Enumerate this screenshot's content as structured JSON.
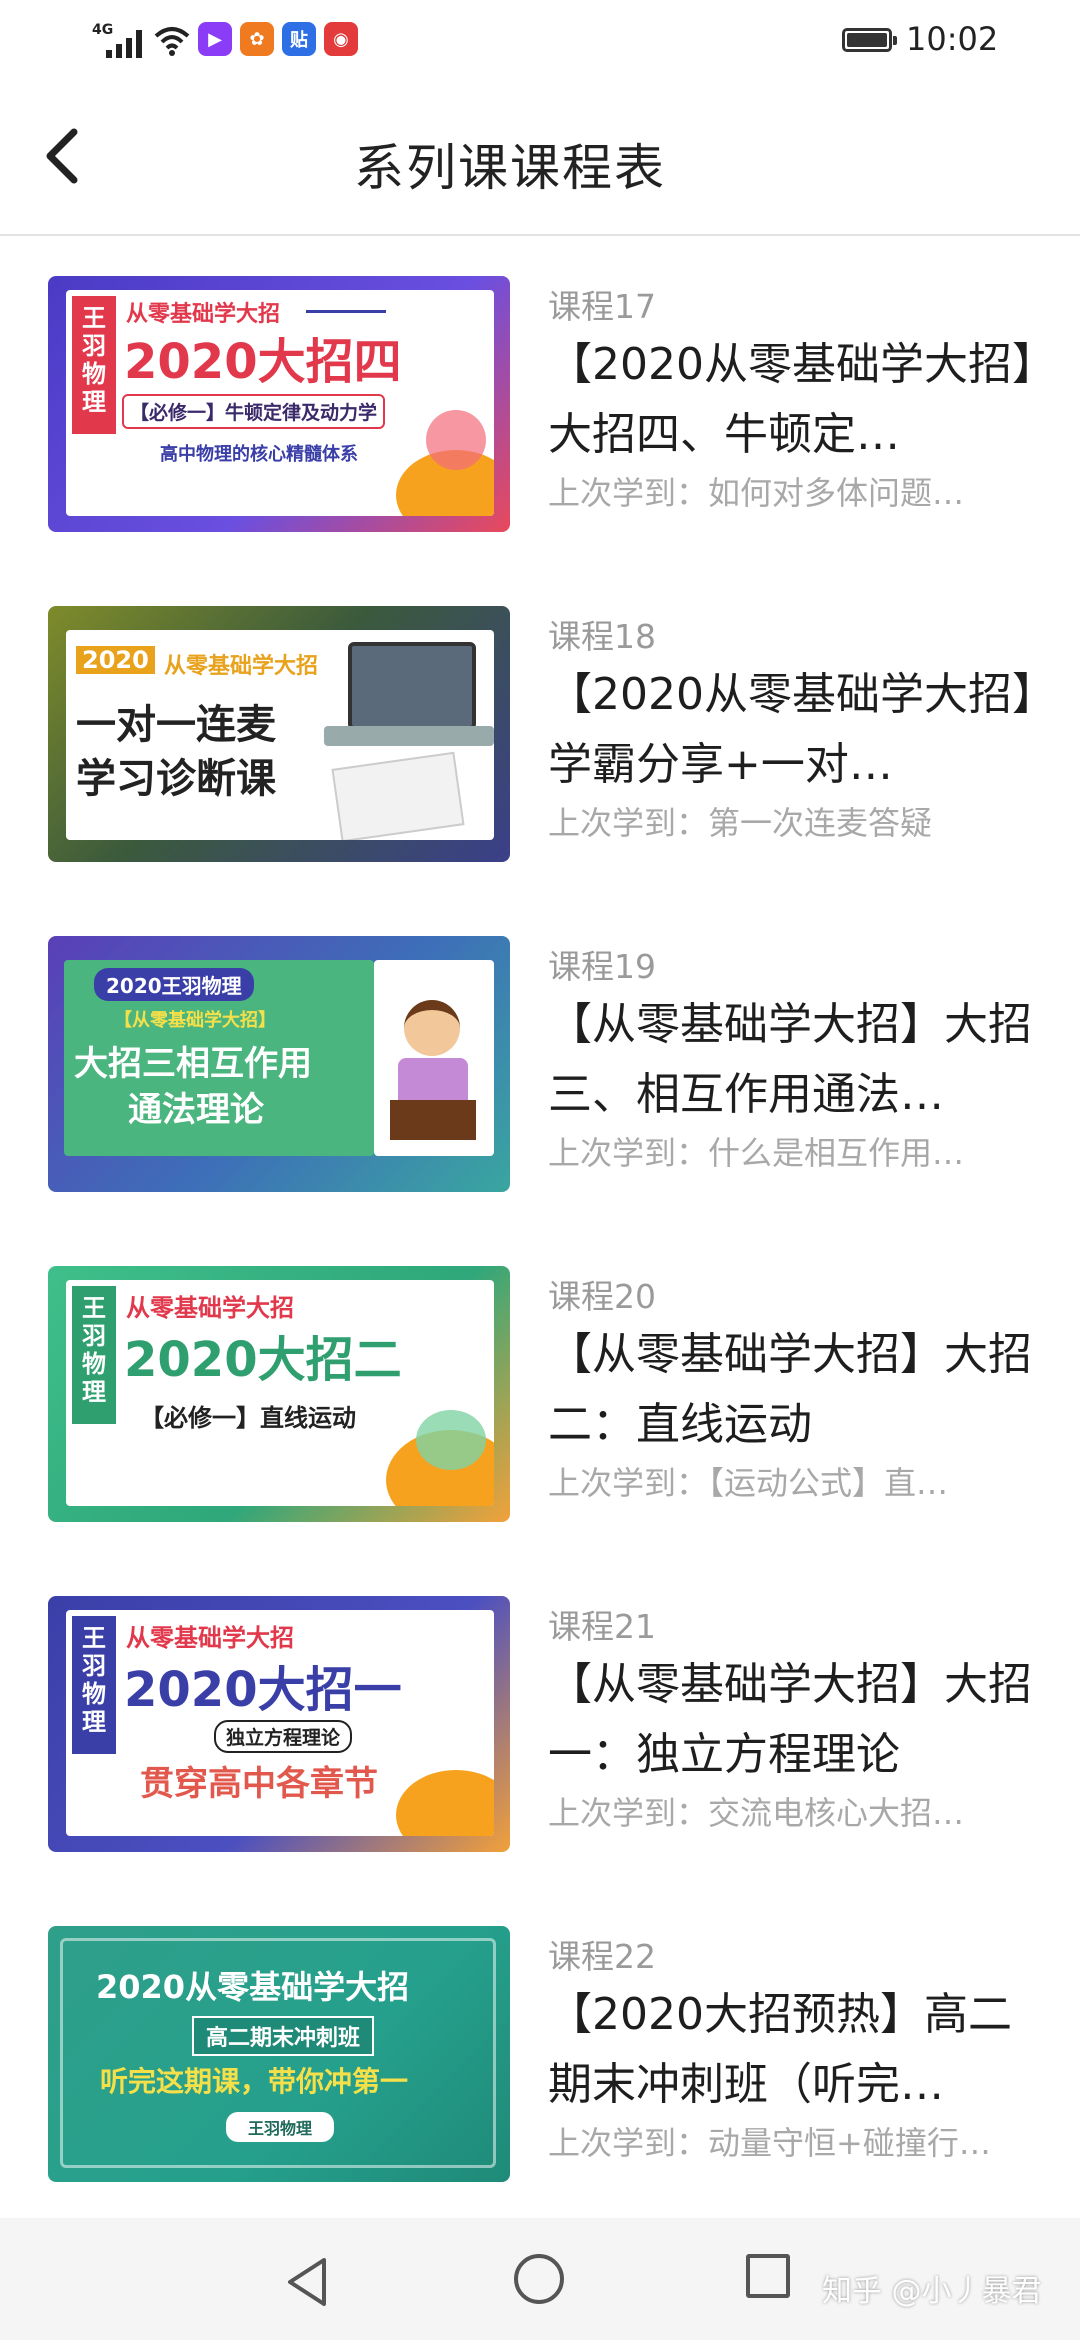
{
  "status_bar": {
    "network": "4G",
    "time": "10:02",
    "app_icons": [
      {
        "name": "video-app-icon",
        "glyph": "▶",
        "color": "#8b3cf7"
      },
      {
        "name": "weibo-icon",
        "glyph": "✿",
        "color": "#f07a20"
      },
      {
        "name": "tieba-icon",
        "glyph": "贴",
        "color": "#2f6fe6"
      },
      {
        "name": "netease-music-icon",
        "glyph": "◉",
        "color": "#e33b3b"
      }
    ]
  },
  "header": {
    "title": "系列课课程表",
    "back_icon": "chevron-left-icon"
  },
  "courses": [
    {
      "number": "课程17",
      "title": "【2020从零基础学大招】大招四、牛顿定…",
      "last": "上次学到：如何对多体问题…",
      "thumb": {
        "badge": "王羽物理",
        "line1": "从零基础学大招",
        "line2": "2020大招四",
        "line3": "【必修一】牛顿定律及动力学",
        "line4": "高中物理的核心精髓体系"
      }
    },
    {
      "number": "课程18",
      "title": "【2020从零基础学大招】学霸分享+一对…",
      "last": "上次学到：第一次连麦答疑",
      "thumb": {
        "year": "2020",
        "line1": "从零基础学大招",
        "line2": "一对一连麦",
        "line3": "学习诊断课"
      }
    },
    {
      "number": "课程19",
      "title": "【从零基础学大招】大招三、相互作用通法…",
      "last": "上次学到：什么是相互作用…",
      "thumb": {
        "line1": "2020王羽物理",
        "line2": "【从零基础学大招】",
        "line3": "大招三相互作用",
        "line4": "通法理论"
      }
    },
    {
      "number": "课程20",
      "title": "【从零基础学大招】大招二：直线运动",
      "last": "上次学到：【运动公式】直…",
      "thumb": {
        "badge": "王羽物理",
        "line1": "从零基础学大招",
        "line2": "2020大招二",
        "line3": "【必修一】直线运动"
      }
    },
    {
      "number": "课程21",
      "title": "【从零基础学大招】大招一：独立方程理论",
      "last": "上次学到：交流电核心大招…",
      "thumb": {
        "badge": "王羽物理",
        "line1": "从零基础学大招",
        "line2": "2020大招一",
        "line3": "独立方程理论",
        "line4": "贯穿高中各章节"
      }
    },
    {
      "number": "课程22",
      "title": "【2020大招预热】高二期末冲刺班（听完…",
      "last": "上次学到：动量守恒+碰撞行…",
      "thumb": {
        "line1": "2020从零基础学大招",
        "line2": "高二期末冲刺班",
        "line3": "听完这期课，带你冲第一",
        "line4": "王羽物理"
      }
    }
  ],
  "bottom_nav": {
    "back_icon": "triangle-back-icon",
    "home_icon": "circle-home-icon",
    "recents_icon": "square-recents-icon"
  },
  "watermark": "知乎 @小丿暴君",
  "colors": {
    "title_text": "#1e1e1e",
    "secondary_text": "#9a9a9a",
    "accent_red": "#e23c4c",
    "accent_blue": "#3a3fa8",
    "accent_green": "#4fae7d"
  }
}
